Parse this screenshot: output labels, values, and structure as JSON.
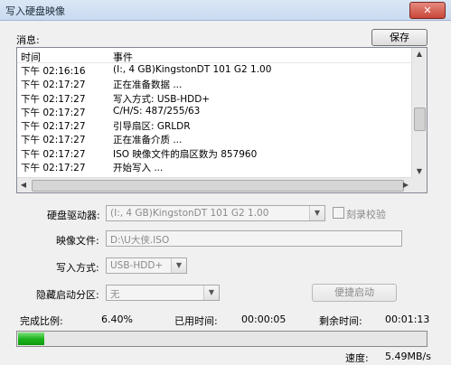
{
  "window": {
    "title": "写入硬盘映像"
  },
  "messages_label": "消息:",
  "save_label": "保存",
  "log": {
    "headers": {
      "time": "时间",
      "event": "事件"
    },
    "rows": [
      {
        "time": "下午 02:16:16",
        "event": "(I:, 4 GB)KingstonDT 101 G2          1.00"
      },
      {
        "time": "下午 02:17:27",
        "event": "正在准备数据 ..."
      },
      {
        "time": "下午 02:17:27",
        "event": "写入方式: USB-HDD+"
      },
      {
        "time": "下午 02:17:27",
        "event": "C/H/S: 487/255/63"
      },
      {
        "time": "下午 02:17:27",
        "event": "引导扇区: GRLDR"
      },
      {
        "time": "下午 02:17:27",
        "event": "正在准备介质 ..."
      },
      {
        "time": "下午 02:17:27",
        "event": "ISO 映像文件的扇区数为 857960"
      },
      {
        "time": "下午 02:17:27",
        "event": "开始写入 ..."
      }
    ]
  },
  "form": {
    "drive_label": "硬盘驱动器:",
    "drive_value": "(I:, 4 GB)KingstonDT 101 G2          1.00",
    "verify_label": "刻录校验",
    "image_label": "映像文件:",
    "image_value": "D:\\U大侠.ISO",
    "write_mode_label": "写入方式:",
    "write_mode_value": "USB-HDD+",
    "hidden_partition_label": "隐藏启动分区:",
    "hidden_partition_value": "无",
    "convenient_boot_label": "便捷启动"
  },
  "status": {
    "complete_label": "完成比例:",
    "complete_value": "6.40%",
    "elapsed_label": "已用时间:",
    "elapsed_value": "00:00:05",
    "remaining_label": "剩余时间:",
    "remaining_value": "00:01:13",
    "progress_fraction": 0.064,
    "speed_label": "速度:",
    "speed_value": "5.49MB/s"
  }
}
